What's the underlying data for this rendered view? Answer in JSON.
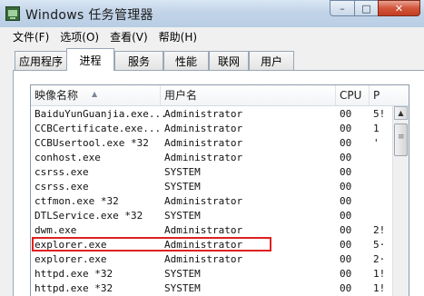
{
  "window": {
    "title": "Windows 任务管理器",
    "controls": {
      "minimize": "–",
      "maximize": "□",
      "close": "✕"
    }
  },
  "menu": [
    "文件(F)",
    "选项(O)",
    "查看(V)",
    "帮助(H)"
  ],
  "tabs": [
    {
      "label": "应用程序",
      "active": false
    },
    {
      "label": "进程",
      "active": true
    },
    {
      "label": "服务",
      "active": false
    },
    {
      "label": "性能",
      "active": false
    },
    {
      "label": "联网",
      "active": false
    },
    {
      "label": "用户",
      "active": false
    }
  ],
  "columns": {
    "image": "映像名称",
    "user": "用户名",
    "cpu": "CPU",
    "mem": "P"
  },
  "rows": [
    {
      "image": "BaiduYunGuanjia.exe...",
      "user": "Administrator",
      "cpu": "00",
      "mem": "5!"
    },
    {
      "image": "CCBCertificate.exe...",
      "user": "Administrator",
      "cpu": "00",
      "mem": "1"
    },
    {
      "image": "CCBUsertool.exe *32",
      "user": "Administrator",
      "cpu": "00",
      "mem": "'"
    },
    {
      "image": "conhost.exe",
      "user": "Administrator",
      "cpu": "00",
      "mem": ""
    },
    {
      "image": "csrss.exe",
      "user": "SYSTEM",
      "cpu": "00",
      "mem": ""
    },
    {
      "image": "csrss.exe",
      "user": "SYSTEM",
      "cpu": "00",
      "mem": ""
    },
    {
      "image": "ctfmon.exe *32",
      "user": "Administrator",
      "cpu": "00",
      "mem": ""
    },
    {
      "image": "DTLService.exe *32",
      "user": "SYSTEM",
      "cpu": "00",
      "mem": ""
    },
    {
      "image": "dwm.exe",
      "user": "Administrator",
      "cpu": "00",
      "mem": "2!"
    },
    {
      "image": "explorer.exe",
      "user": "Administrator",
      "cpu": "00",
      "mem": "5·"
    },
    {
      "image": "explorer.exe",
      "user": "Administrator",
      "cpu": "00",
      "mem": "2·"
    },
    {
      "image": "httpd.exe *32",
      "user": "SYSTEM",
      "cpu": "00",
      "mem": "1!"
    },
    {
      "image": "httpd.exe *32",
      "user": "SYSTEM",
      "cpu": "00",
      "mem": "1!"
    }
  ],
  "highlight": {
    "color": "#e02020"
  }
}
